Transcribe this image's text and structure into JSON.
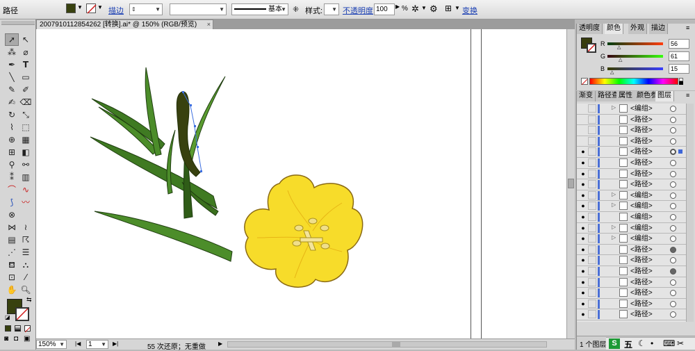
{
  "control_bar": {
    "object_type": "路径",
    "stroke_label": "描边",
    "stroke_weight": "",
    "stroke_style_value": "",
    "profile_value": "基本",
    "style_label": "样式:",
    "opacity_label": "不透明度",
    "opacity_value": "100",
    "opacity_unit": "%",
    "transform_label": "变换",
    "fill_color": "#38410f"
  },
  "document": {
    "tab_title": "2007910112854262 [转换].ai* @ 150% (RGB/预览)",
    "close_glyph": "×"
  },
  "status_bar": {
    "zoom": "150%",
    "artboard": "1",
    "history": "55 次还原；无重做"
  },
  "color_panel": {
    "tabs": [
      "透明度",
      "颜色",
      "外观",
      "描边"
    ],
    "active_tab": "颜色",
    "channels": [
      {
        "name": "R",
        "value": "56"
      },
      {
        "name": "G",
        "value": "61"
      },
      {
        "name": "B",
        "value": "15"
      }
    ],
    "fill_color": "#383d0f"
  },
  "layers_panel": {
    "tabs": [
      "渐变",
      "路径查",
      "属性",
      "颜色参",
      "图层"
    ],
    "active_tab": "图层",
    "rows": [
      {
        "name": "<编组>",
        "eye": false,
        "expand": true,
        "target": "empty"
      },
      {
        "name": "<路径>",
        "eye": false,
        "expand": false,
        "target": "empty"
      },
      {
        "name": "<路径>",
        "eye": false,
        "expand": false,
        "target": "empty"
      },
      {
        "name": "<路径>",
        "eye": false,
        "expand": false,
        "target": "empty"
      },
      {
        "name": "<路径>",
        "eye": true,
        "expand": false,
        "target": "selected"
      },
      {
        "name": "<路径>",
        "eye": true,
        "expand": false,
        "target": "empty"
      },
      {
        "name": "<路径>",
        "eye": true,
        "expand": false,
        "target": "empty"
      },
      {
        "name": "<路径>",
        "eye": true,
        "expand": false,
        "target": "empty"
      },
      {
        "name": "<编组>",
        "eye": true,
        "expand": true,
        "target": "empty"
      },
      {
        "name": "<编组>",
        "eye": true,
        "expand": true,
        "target": "empty"
      },
      {
        "name": "<编组>",
        "eye": true,
        "expand": false,
        "target": "empty"
      },
      {
        "name": "<编组>",
        "eye": true,
        "expand": true,
        "target": "empty"
      },
      {
        "name": "<编组>",
        "eye": true,
        "expand": true,
        "target": "empty"
      },
      {
        "name": "<路径>",
        "eye": true,
        "expand": false,
        "target": "filled"
      },
      {
        "name": "<路径>",
        "eye": true,
        "expand": false,
        "target": "empty"
      },
      {
        "name": "<路径>",
        "eye": true,
        "expand": false,
        "target": "filled"
      },
      {
        "name": "<路径>",
        "eye": true,
        "expand": false,
        "target": "empty"
      },
      {
        "name": "<路径>",
        "eye": true,
        "expand": false,
        "target": "empty"
      },
      {
        "name": "<路径>",
        "eye": true,
        "expand": false,
        "target": "empty"
      },
      {
        "name": "<路径>",
        "eye": true,
        "expand": false,
        "target": "empty"
      }
    ],
    "footer_text": "1 个图层"
  },
  "taskbar": {
    "ime_label": "五"
  }
}
